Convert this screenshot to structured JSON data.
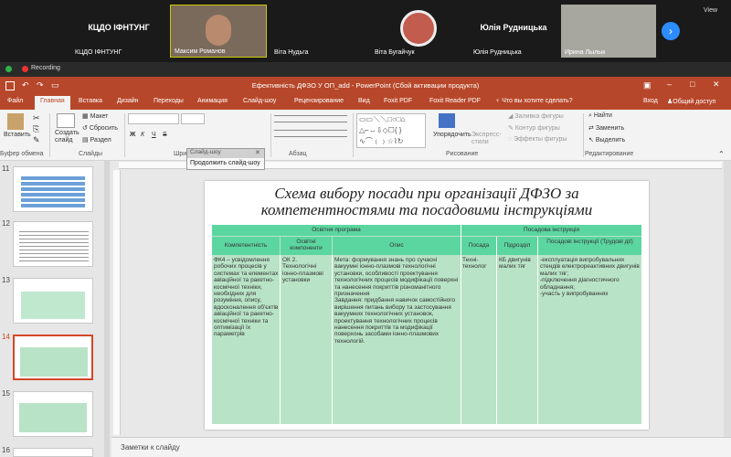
{
  "zoom": {
    "tiles": [
      {
        "name": "КЦДО ІФНТУНГ",
        "big_label": "КЦДО ІФНТУНГ"
      },
      {
        "name": "Максим Романов"
      },
      {
        "name": "Віта Нудьга"
      },
      {
        "name": "Віта Бугайчук"
      },
      {
        "name": "Юлія Рудницька",
        "big_label": "Юлія Рудницька"
      },
      {
        "name": "Ирина Лылык"
      }
    ],
    "view_label": "View",
    "recording_label": "Recording"
  },
  "powerpoint": {
    "window_title": "Ефективність ДФЗО У ОП_add - PowerPoint (Сбой активации продукта)",
    "tabs": [
      "Файл",
      "Главная",
      "Вставка",
      "Дизайн",
      "Переходы",
      "Анимация",
      "Слайд-шоу",
      "Рецензирование",
      "Вид",
      "Foxit PDF",
      "Foxit Reader PDF"
    ],
    "tell_me": "Что вы хотите сделать?",
    "sign_in": "Вход",
    "share": "Общий доступ",
    "ribbon": {
      "paste": "Вставить",
      "clipboard_group": "Буфер обмена",
      "new_slide": "Создать слайд",
      "layout": "Макет",
      "reset": "Сбросить",
      "section": "Раздел",
      "slides_group": "Слайды",
      "font_group": "Шри",
      "paragraph_group": "Абзац",
      "arrange": "Упорядочить",
      "quick_styles": "Экспресс-стили",
      "shape_fill": "Заливка фигуры",
      "shape_outline": "Контур фигуры",
      "shape_effects": "Эффекты фигуры",
      "drawing_group": "Рисование",
      "find": "Найти",
      "replace": "Заменить",
      "select": "Выделить",
      "editing_group": "Редактирование"
    },
    "slideshow_popup": {
      "title": "Слайд-шоу",
      "continue": "Продолжить слайд-шоу"
    },
    "thumbnail_numbers": [
      "11",
      "12",
      "13",
      "14",
      "15",
      "16"
    ],
    "active_slide": "14",
    "notes_placeholder": "Заметки к слайду",
    "accent": "#b7472a"
  },
  "slide": {
    "title_line1": "Схема вибору посади при організації ДФЗО за",
    "title_line2": "компетентностями та посадовими інструкціями",
    "table": {
      "group_headers": [
        "Освітня програма",
        "Посадова інструкція"
      ],
      "col_headers": [
        "Компетентність",
        "Освітні компоненти",
        "Опис",
        "Посада",
        "Підрозділ",
        "Посадові інструкції (Трудові дії)"
      ],
      "row": [
        "ФК4 – усвідомлення робочих процесів у системах та елементах авіаційної та ракетно-космічної техніки, необхідних для розуміння, опису, вдосконалення об'єктів авіаційної та ракетно-космічної техніки та оптимізації їх параметрів",
        "ОК 2. Технологічні іонно-плазмові установки",
        "Мета: формування знань про сучасні вакуумні іонно-плазмові технологічні установки, особливості проектування\nтехнологічних процесів модифікації поверхні та нанесення покриттів різноманітного призначення\nЗавдання: придбання навичок самостійного\nвирішення питань вибору та застосування\nвакуумних технологічних установок, проектування технологічних процесів\nнанесення покриттів та модифікації поверхонь засобами іонно-плазмових\nтехнологій.",
        "Техні-технолог",
        "КБ двигунів малих тяг",
        "-експлуатація випробувальних стендів електрореактивних двигунів малих тяг;\n-підключення діагностичного обладнання;\n-участь у випробуваннях"
      ]
    },
    "header_color": "#5cd6a0",
    "body_color": "#b9e3c6"
  }
}
